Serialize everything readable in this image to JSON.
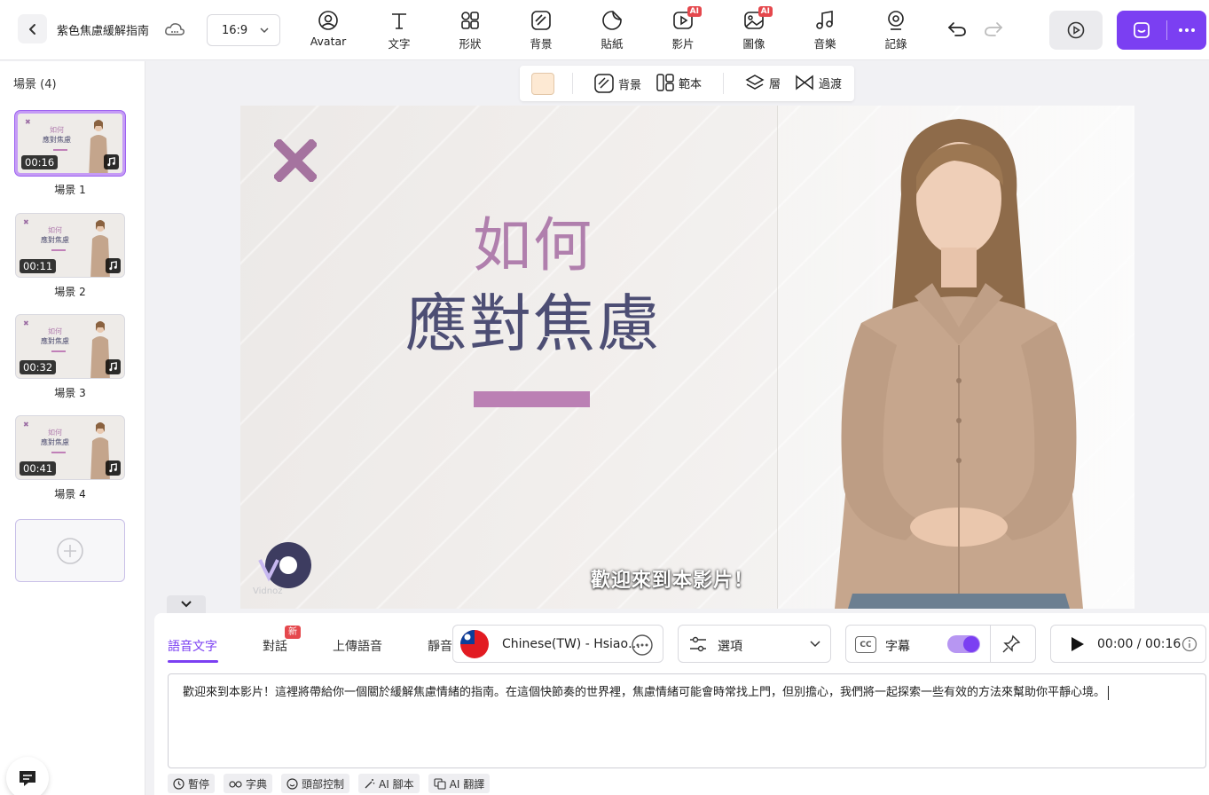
{
  "header": {
    "project_title": "紫色焦慮緩解指南",
    "aspect_ratio": "16:9",
    "tools": [
      {
        "label": "Avatar",
        "icon": "avatar-icon"
      },
      {
        "label": "文字",
        "icon": "text-icon"
      },
      {
        "label": "形狀",
        "icon": "shapes-icon"
      },
      {
        "label": "背景",
        "icon": "background-icon"
      },
      {
        "label": "貼紙",
        "icon": "sticker-icon"
      },
      {
        "label": "影片",
        "icon": "video-icon",
        "badge": "AI"
      },
      {
        "label": "圖像",
        "icon": "image-icon",
        "badge": "AI"
      },
      {
        "label": "音樂",
        "icon": "music-icon"
      },
      {
        "label": "記錄",
        "icon": "record-icon"
      }
    ]
  },
  "scenes": {
    "header": "場景 (4)",
    "items": [
      {
        "label": "場景 1",
        "duration": "00:16",
        "thumb_title1": "如何",
        "thumb_title2": "應對焦慮",
        "active": true
      },
      {
        "label": "場景 2",
        "duration": "00:11",
        "thumb_title1": "如何",
        "thumb_title2": "應對焦慮",
        "active": false
      },
      {
        "label": "場景 3",
        "duration": "00:32",
        "thumb_title1": "如何",
        "thumb_title2": "應對焦慮",
        "active": false
      },
      {
        "label": "場景 4",
        "duration": "00:41",
        "thumb_title1": "如何",
        "thumb_title2": "應對焦慮",
        "active": false
      }
    ]
  },
  "canvas_toolbar": {
    "color": "#fde9d3",
    "background_label": "背景",
    "template_label": "範本",
    "layer_label": "層",
    "transition_label": "過渡"
  },
  "stage": {
    "title_line1": "如何",
    "title_line2": "應對焦慮",
    "subtitle": "歡迎來到本影片！",
    "watermark": "Vidnoz",
    "colors": {
      "title1": "#b07fad",
      "title2": "#4d4e74",
      "accent": "#bb80b4"
    }
  },
  "editor": {
    "tabs": [
      "語音文字",
      "對話",
      "上傳語音",
      "靜音"
    ],
    "new_badge": "新",
    "voice_name": "Chinese(TW) - Hsiao…",
    "options_label": "選項",
    "subtitles_label": "字幕",
    "subtitles_enabled": true,
    "time": "00:00 / 00:16",
    "script": "歡迎來到本影片！這裡將帶給你一個關於緩解焦慮情緒的指南。在這個快節奏的世界裡，焦慮情緒可能會時常找上門，但別擔心，我們將一起探索一些有效的方法來幫助你平靜心境。",
    "chips": [
      "暫停",
      "字典",
      "頭部控制",
      "AI 腳本",
      "AI 翻譯"
    ]
  },
  "theme": {
    "accent": "#7b3ff2"
  }
}
